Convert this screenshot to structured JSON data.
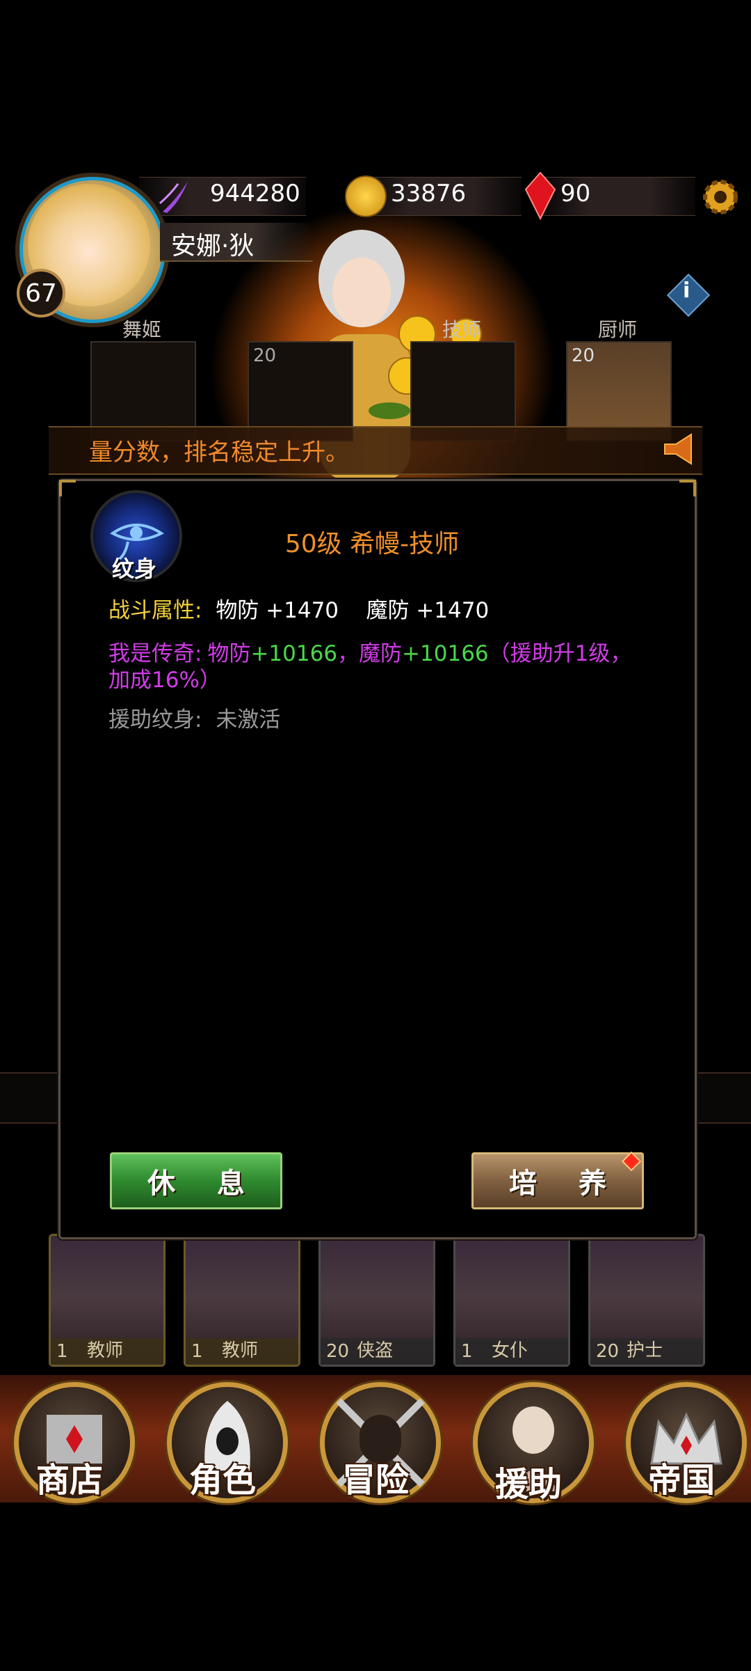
{
  "header": {
    "level": "67",
    "player_name": "安娜·狄",
    "resources": [
      {
        "name": "purple-energy",
        "icon": "purple-claw-icon",
        "value": "944280"
      },
      {
        "name": "gold",
        "icon": "gold-coin-icon",
        "value": "33876"
      },
      {
        "name": "gem",
        "icon": "red-gem-icon",
        "value": "90"
      }
    ]
  },
  "roster": {
    "slots": [
      {
        "label": "舞姬",
        "level": ""
      },
      {
        "label": "",
        "level": "20"
      },
      {
        "label": "技师",
        "level": ""
      },
      {
        "label": "厨师",
        "level": "20"
      }
    ]
  },
  "ticker": {
    "text": "量分数，排名稳定上升。"
  },
  "dialog": {
    "icon_label": "纹身",
    "title": "50级 希幔-技师",
    "battle_label": "战斗属性:",
    "battle_value": "物防 +1470    魔防 +1470",
    "legend_label": "我是传奇:",
    "legend_phys_label": "物防",
    "legend_phys_value": "+10166",
    "legend_sep": "，魔防",
    "legend_magic_value": "+10166",
    "legend_note": "（援助升1级，加成16%）",
    "assist_label": "援助纹身:",
    "assist_value": "未激活",
    "rest_button": "休息",
    "train_button": "培养"
  },
  "cards": [
    {
      "level": "1",
      "role": "教师"
    },
    {
      "level": "1",
      "role": "教师"
    },
    {
      "level": "20",
      "role": "侠盗"
    },
    {
      "level": "1",
      "role": "女仆"
    },
    {
      "level": "20",
      "role": "护士"
    }
  ],
  "nav": [
    {
      "label": "商店",
      "icon": "castle-icon"
    },
    {
      "label": "角色",
      "icon": "hooded-figure-icon"
    },
    {
      "label": "冒险",
      "icon": "crossed-swords-icon"
    },
    {
      "label": "援助",
      "icon": "assistant-portrait-icon"
    },
    {
      "label": "帝国",
      "icon": "crown-icon"
    }
  ],
  "colors": {
    "accent_orange": "#f0902a",
    "battle_yellow": "#f2d13a",
    "legend_purple": "#d23ce8",
    "legend_green": "#4ad84a",
    "muted_gray": "#9a9a9a"
  }
}
